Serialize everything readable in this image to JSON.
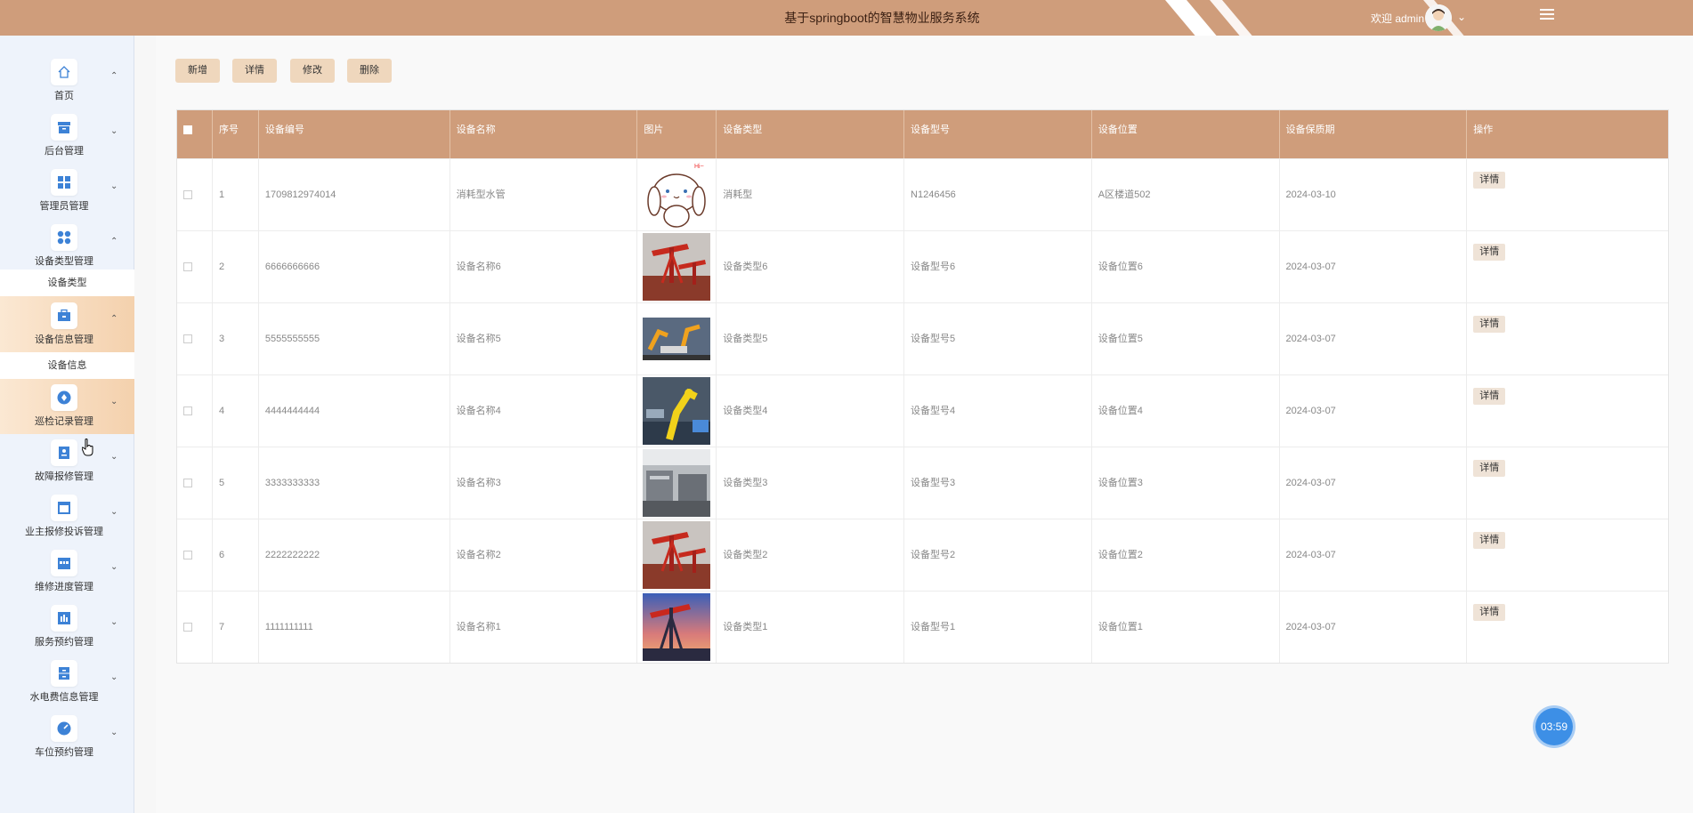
{
  "header": {
    "title": "基于springboot的智慧物业服务系统",
    "welcome": "欢迎 admin",
    "accent": "#cf9d7b"
  },
  "sidebar": {
    "items": [
      {
        "label": "首页",
        "icon": "home-icon"
      },
      {
        "label": "后台管理",
        "icon": "archive-icon"
      },
      {
        "label": "管理员管理",
        "icon": "grid-icon"
      },
      {
        "label": "设备类型管理",
        "icon": "dots-icon"
      },
      {
        "label": "设备信息管理",
        "icon": "briefcase-icon"
      },
      {
        "label": "巡检记录管理",
        "icon": "compass-icon"
      },
      {
        "label": "故障报修管理",
        "icon": "badge-icon"
      },
      {
        "label": "业主报修投诉管理",
        "icon": "window-icon"
      },
      {
        "label": "维修进度管理",
        "icon": "store-icon"
      },
      {
        "label": "服务预约管理",
        "icon": "chart-icon"
      },
      {
        "label": "水电费信息管理",
        "icon": "cabinet-icon"
      },
      {
        "label": "车位预约管理",
        "icon": "gauge-icon"
      }
    ],
    "sub_items": {
      "device_type": "设备类型",
      "device_info": "设备信息"
    }
  },
  "toolbar": {
    "add": "新增",
    "detail": "详情",
    "edit": "修改",
    "delete": "删除"
  },
  "table": {
    "headers": [
      "序号",
      "设备编号",
      "设备名称",
      "图片",
      "设备类型",
      "设备型号",
      "设备位置",
      "设备保质期",
      "操作"
    ],
    "rows": [
      {
        "no": "1",
        "code": "1709812974014",
        "name": "消耗型水管",
        "type": "消耗型",
        "model": "N1246456",
        "location": "A区楼道502",
        "warranty": "2024-03-10",
        "action": "详情"
      },
      {
        "no": "2",
        "code": "6666666666",
        "name": "设备名称6",
        "type": "设备类型6",
        "model": "设备型号6",
        "location": "设备位置6",
        "warranty": "2024-03-07",
        "action": "详情"
      },
      {
        "no": "3",
        "code": "5555555555",
        "name": "设备名称5",
        "type": "设备类型5",
        "model": "设备型号5",
        "location": "设备位置5",
        "warranty": "2024-03-07",
        "action": "详情"
      },
      {
        "no": "4",
        "code": "4444444444",
        "name": "设备名称4",
        "type": "设备类型4",
        "model": "设备型号4",
        "location": "设备位置4",
        "warranty": "2024-03-07",
        "action": "详情"
      },
      {
        "no": "5",
        "code": "3333333333",
        "name": "设备名称3",
        "type": "设备类型3",
        "model": "设备型号3",
        "location": "设备位置3",
        "warranty": "2024-03-07",
        "action": "详情"
      },
      {
        "no": "6",
        "code": "2222222222",
        "name": "设备名称2",
        "type": "设备类型2",
        "model": "设备型号2",
        "location": "设备位置2",
        "warranty": "2024-03-07",
        "action": "详情"
      },
      {
        "no": "7",
        "code": "1111111111",
        "name": "设备名称1",
        "type": "设备类型1",
        "model": "设备型号1",
        "location": "设备位置1",
        "warranty": "2024-03-07",
        "action": "详情"
      }
    ]
  },
  "timer": "03:59"
}
